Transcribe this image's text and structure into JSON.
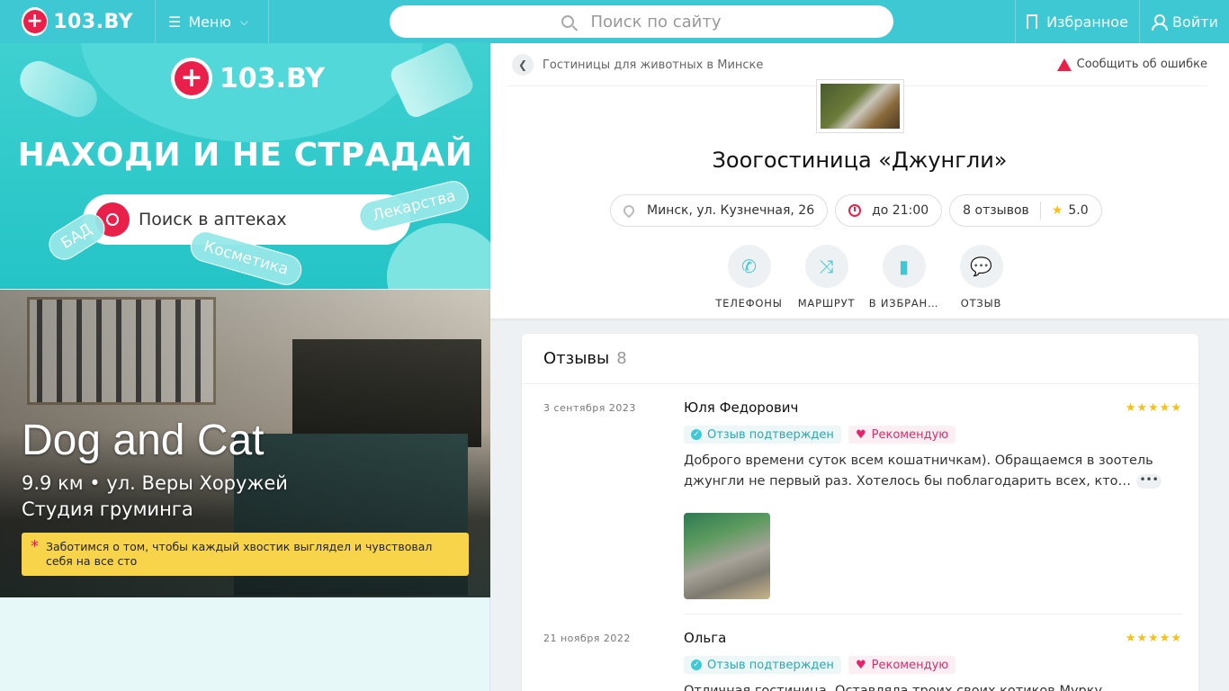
{
  "header": {
    "logo_text": "103.BY",
    "logo_symbol": "+",
    "menu_label": "Меню",
    "search_placeholder": "Поиск по сайту",
    "favorites_label": "Избранное",
    "login_label": "Войти"
  },
  "banner": {
    "logo_text": "103.BY",
    "slogan": "НАХОДИ И НЕ СТРАДАЙ",
    "search_label": "Поиск в аптеках",
    "tags": [
      "БАД",
      "Лекарства",
      "Косметика"
    ]
  },
  "promo": {
    "title": "Dog and Cat",
    "subtitle": "9.9 км • ул. Веры Хоружей",
    "category": "Студия груминга",
    "note": "Заботимся о том, чтобы каждый хвостик выглядел и чувствовал себя на все сто"
  },
  "place": {
    "breadcrumb": "Гостиницы для животных в Минске",
    "report_label": "Сообщить об ошибке",
    "name": "Зоогостиница «Джунгли»",
    "address": "Минск, ул. Кузнечная, 26",
    "hours": "до 21:00",
    "reviews_count_label": "8 отзывов",
    "rating": "5.0",
    "actions": [
      {
        "label": "ТЕЛЕФОНЫ",
        "icon": "phone-icon"
      },
      {
        "label": "МАРШРУТ",
        "icon": "route-icon"
      },
      {
        "label": "В ИЗБРАН…",
        "icon": "bookmark-icon"
      },
      {
        "label": "ОТЗЫВ",
        "icon": "chat-icon"
      }
    ]
  },
  "reviews": {
    "heading": "Отзывы",
    "count": "8",
    "items": [
      {
        "date": "3 сентября 2023",
        "author": "Юля Федорович",
        "stars": "★★★★★",
        "verified": "Отзыв подтвержден",
        "recommend": "Рекомендую",
        "text": "Доброго времени суток всем кошатничкам). Обращаемся в зоотель джунгли не первый раз. Хотелось бы поблагодарить всех, кто…",
        "more": "•••"
      },
      {
        "date": "21 ноября 2022",
        "author": "Ольга",
        "stars": "★★★★★",
        "verified": "Отзыв подтвержден",
        "recommend": "Рекомендую",
        "text": "Отличная гостиница. Оставляла троих своих котиков Мурку"
      }
    ]
  },
  "colors": {
    "brand": "#3ec8d4",
    "accent_red": "#e8204a",
    "star": "#f5c118",
    "note_bg": "#f8d44a"
  }
}
